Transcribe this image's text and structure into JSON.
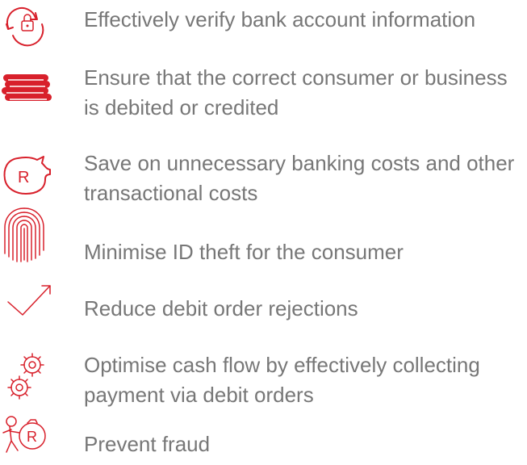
{
  "accent_color": "#d8202b",
  "text_color": "#777777",
  "benefits": [
    {
      "icon": "lock-refresh-icon",
      "text": "Effectively verify bank account information"
    },
    {
      "icon": "coin-stack-icon",
      "text": "Ensure that the correct consumer or business is debited or credited"
    },
    {
      "icon": "piggy-bank-rand-icon",
      "text": "Save on unnecessary banking costs and other transactional costs"
    },
    {
      "icon": "fingerprint-icon",
      "text": "Minimise ID theft for the consumer"
    },
    {
      "icon": "trend-up-arrow-icon",
      "text": "Reduce debit order rejections"
    },
    {
      "icon": "gears-icon",
      "text": "Optimise cash flow by effectively collecting payment via debit orders"
    },
    {
      "icon": "thief-money-bag-icon",
      "text": "Prevent fraud",
      "icon_text": "R"
    }
  ],
  "piggy_symbol": "R"
}
